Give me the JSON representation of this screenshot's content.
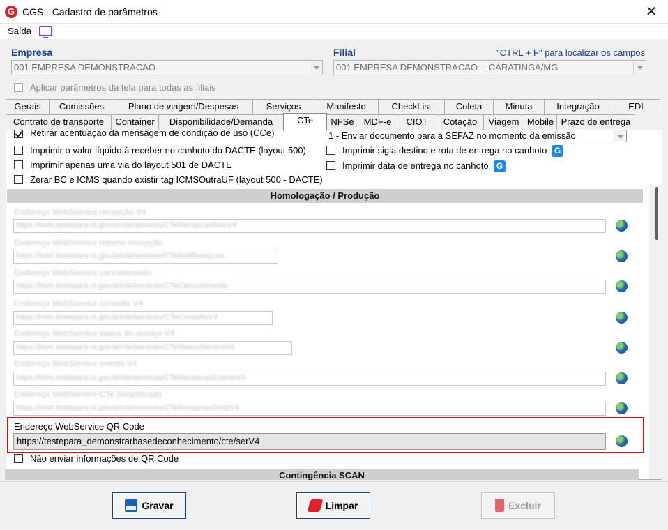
{
  "window": {
    "title": "CGS - Cadastro de parâmetros",
    "logo_letter": "G",
    "close_glyph": "✕"
  },
  "menu": {
    "saida": "Saída"
  },
  "filters": {
    "empresa_label": "Empresa",
    "empresa_value": "001 EMPRESA DEMONSTRACAO",
    "filial_label": "Filial",
    "filial_value": "001 EMPRESA DEMONSTRACAO -- CARATINGA/MG",
    "hint": "\"CTRL + F\" para localizar os campos",
    "apply_all": "Aplicar parâmetros da tela para todas as filiais"
  },
  "tabs_row1": [
    "Gerais",
    "Comissões",
    "Plano de viagem/Despesas",
    "Serviços",
    "Manifesto",
    "CheckList",
    "Coleta",
    "Minuta",
    "Integração",
    "EDI"
  ],
  "tabs_row2": [
    "Contrato de transporte",
    "Container",
    "Disponibilidade/Demanda",
    "CTe",
    "NFSe",
    "MDF-e",
    "CIOT",
    "Cotação",
    "Viagem",
    "Mobile",
    "Prazo de entrega"
  ],
  "options": {
    "opt1": "Retirar acentuação da mensagem de condição de uso (CCe)",
    "opt2": "Imprimir o valor líquido à receber no canhoto do DACTE (layout 500)",
    "opt3": "Imprimir apenas uma via do layout 501 de DACTE",
    "opt4": "Zerar BC e ICMS quando existir tag ICMSOutraUF (layout 500 - DACTE)",
    "send_select": "1 - Enviar documento para a SEFAZ no momento da emissão",
    "opt5": "Imprimir sigla destino e rota de entrega no canhoto",
    "opt6": "Imprimir data de entrega no canhoto",
    "badge_letter": "G"
  },
  "section": {
    "homologacao": "Homologação / Produção",
    "contingencia": "Contingência SCAN"
  },
  "webservices": [
    {
      "label": "Endereço WebService recepção V4",
      "url": "https://hom.testepara.rs.gov.br/cte/services/CTeRecepcaoSincV4"
    },
    {
      "label": "Endereço WebService retorno recepção",
      "url": "https://hom.testepara.rs.gov.br/cte/services/CTeRetRecepcao"
    },
    {
      "label": "Endereço WebService cancelamento",
      "url": "https://hom.testepara.rs.gov.br/cte/services/CTeCancelamento"
    },
    {
      "label": "Endereço WebService consulta V4",
      "url": "https://hom.testepara.rs.gov.br/cte/services/CTeConsultaV4"
    },
    {
      "label": "Endereço WebService status do serviço V4",
      "url": "https://hom.testepara.rs.gov.br/cte/services/CTeStatusServicoV4"
    },
    {
      "label": "Endereço WebService evento V4",
      "url": "https://hom.testepara.rs.gov.br/cte/services/CTeRecepcaoEventoV4"
    },
    {
      "label": "Endereço WebService CTe Simplificado",
      "url": "https://hom.testepara.rs.gov.br/cte/services/CTeRecepcaoSimpV4"
    }
  ],
  "qrcode": {
    "label": "Endereço WebService QR Code",
    "value": "https://testepara_demonstrarbasedeconhecimento/cte/serV4",
    "no_send": "Não enviar informações de QR Code"
  },
  "buttons": {
    "gravar": "Gravar",
    "limpar": "Limpar",
    "excluir": "Excluir"
  },
  "colors": {
    "accent": "#1a3f8f",
    "highlight": "#e01010",
    "logo": "#d6202a"
  }
}
